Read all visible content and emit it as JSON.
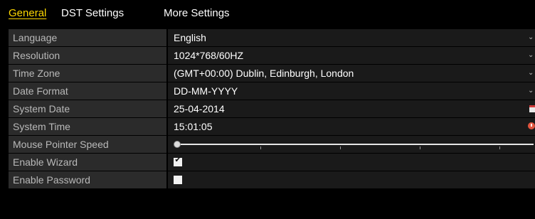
{
  "tabs": [
    {
      "label": "General",
      "active": true
    },
    {
      "label": "DST Settings",
      "active": false
    },
    {
      "label": "More Settings",
      "active": false
    }
  ],
  "fields": {
    "language": {
      "label": "Language",
      "value": "English"
    },
    "resolution": {
      "label": "Resolution",
      "value": "1024*768/60HZ"
    },
    "time_zone": {
      "label": "Time Zone",
      "value": "(GMT+00:00) Dublin, Edinburgh, London"
    },
    "date_format": {
      "label": "Date Format",
      "value": "DD-MM-YYYY"
    },
    "system_date": {
      "label": "System Date",
      "value": "25-04-2014"
    },
    "system_time": {
      "label": "System Time",
      "value": "15:01:05"
    },
    "mouse_pointer_speed": {
      "label": "Mouse Pointer Speed",
      "value_fraction": 0.0
    },
    "enable_wizard": {
      "label": "Enable Wizard",
      "checked": true
    },
    "enable_password": {
      "label": "Enable Password",
      "checked": false
    }
  },
  "icons": {
    "dropdown": "chevron-down-icon",
    "date_picker": "calendar-icon",
    "time_picker": "clock-icon"
  },
  "colors": {
    "active_tab": "#ffd800",
    "label_bg": "#2b2b2b",
    "value_bg": "#1a1a1a",
    "background": "#000000"
  }
}
